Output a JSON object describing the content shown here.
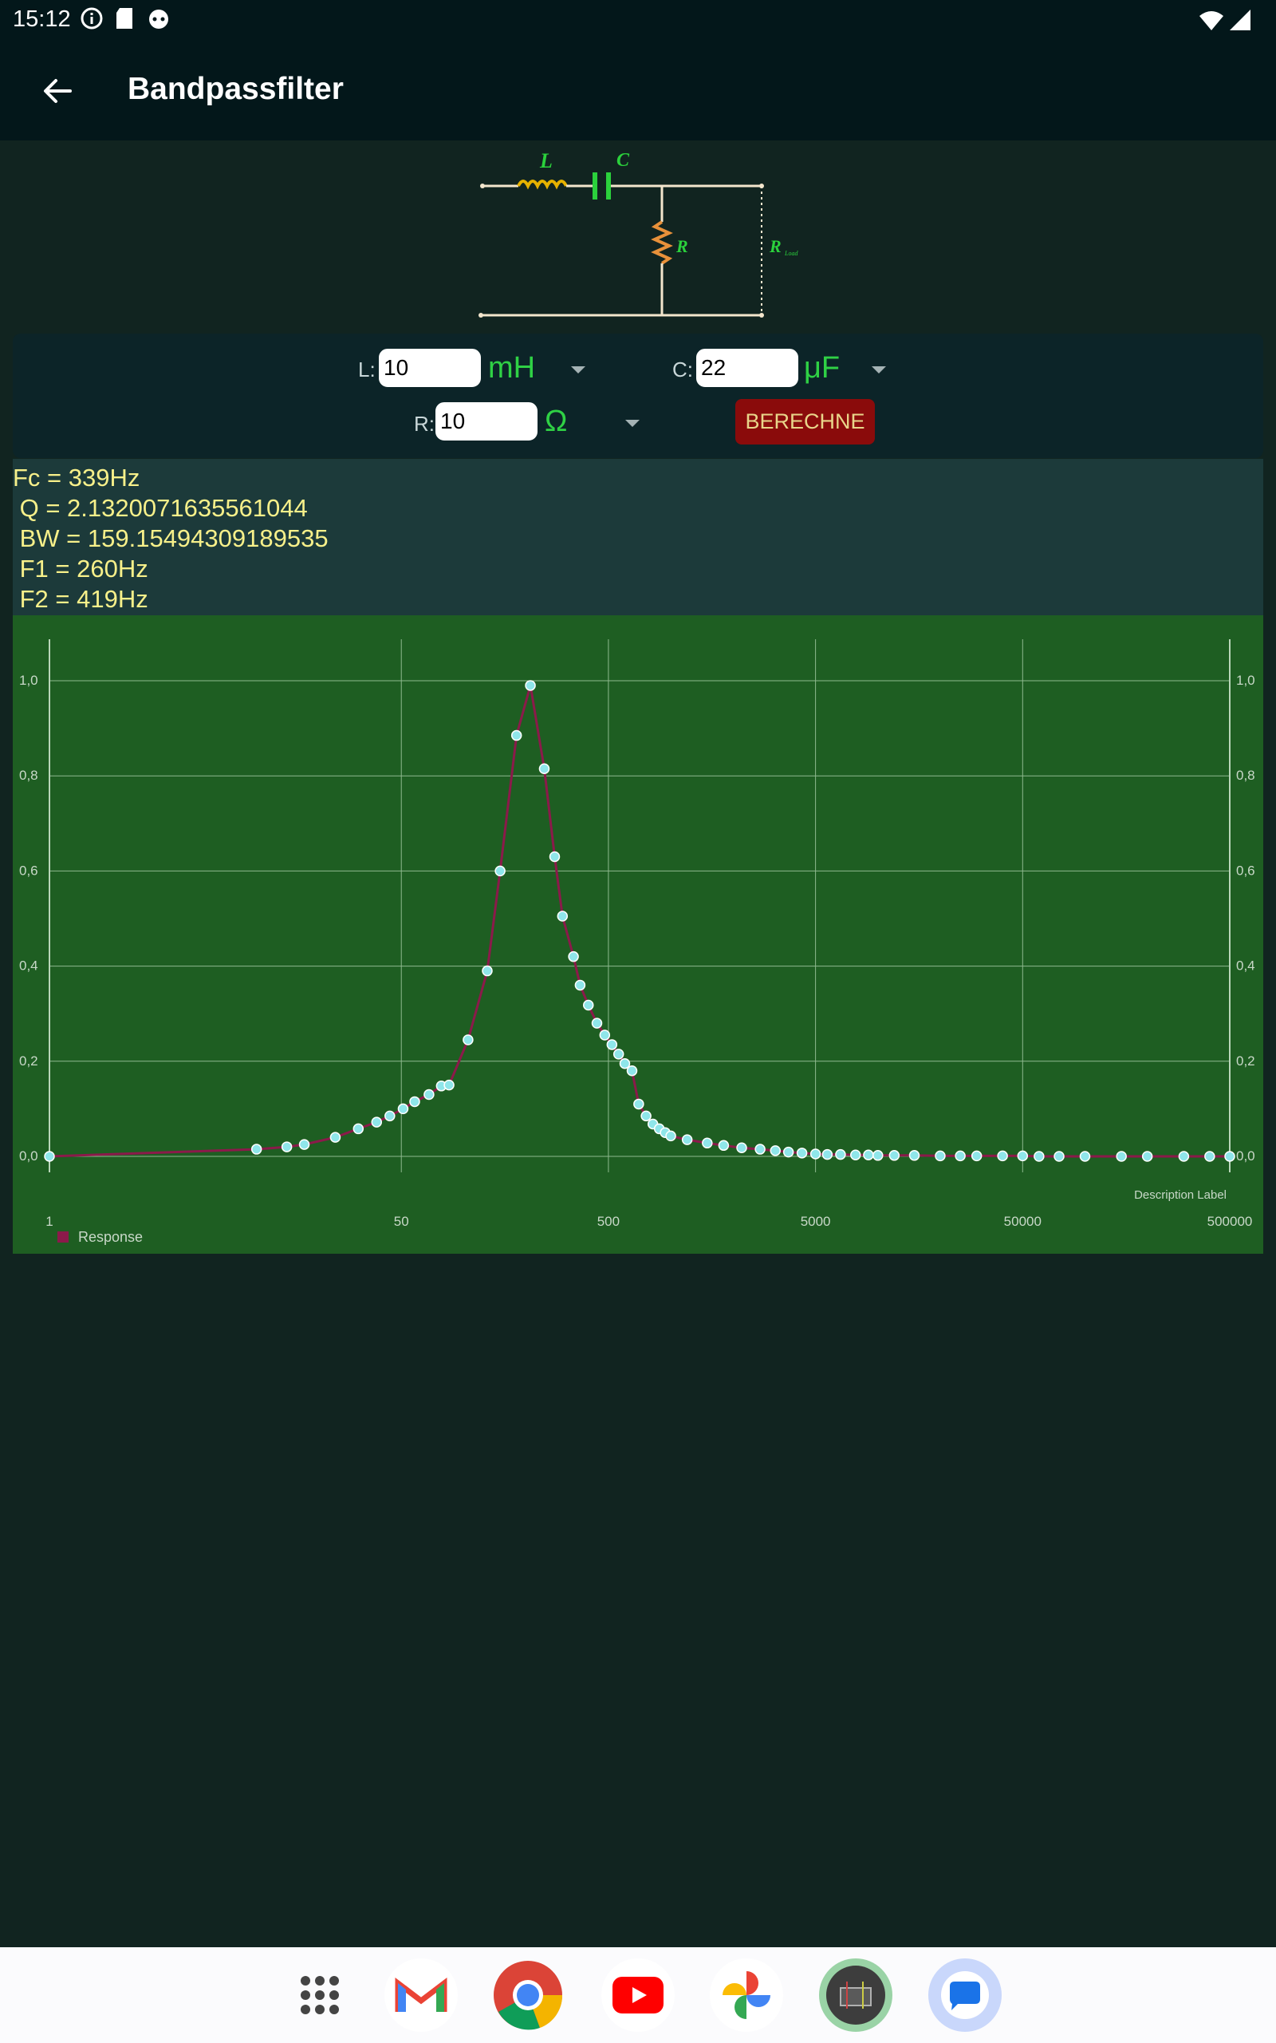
{
  "status_bar": {
    "time": "15:12",
    "icons": [
      "info-icon",
      "sd-card-icon",
      "robot-icon",
      "wifi-icon",
      "signal-icon"
    ]
  },
  "app_bar": {
    "title": "Bandpassfilter",
    "back_icon": "arrow-left-icon"
  },
  "circuit": {
    "label_L": "L",
    "label_C": "C",
    "label_R": "R",
    "label_RLoad": "R",
    "label_RLoad_sub": "Load"
  },
  "inputs": {
    "L": {
      "label": "L:",
      "value": "10",
      "unit": "mH"
    },
    "C": {
      "label": "C:",
      "value": "22",
      "unit": "μF"
    },
    "R": {
      "label": "R:",
      "value": "10",
      "unit": "Ω"
    },
    "calculate_label": "BERECHNE"
  },
  "results": {
    "fc": "Fc = 339Hz",
    "q": " Q = 2.1320071635561044",
    "bw": " BW = 159.15494309189535",
    "f1": " F1 = 260Hz",
    "f2": " F2 = 419Hz"
  },
  "colors": {
    "app_bar": "#03171a",
    "background": "#112420",
    "panel": "#0c2428",
    "results_bg": "#1c3a3a",
    "results_text": "#f7f08a",
    "chart_bg": "#1e5e22",
    "line": "#8b1a4a",
    "marker": "#8fe6ea",
    "button": "#8a0b0b",
    "unit_text": "#2fd145"
  },
  "chart_data": {
    "type": "line",
    "x_scale": "log",
    "xlim": [
      1,
      500000
    ],
    "ylim": [
      0,
      1
    ],
    "x_ticks": [
      "1",
      "50",
      "500",
      "5000",
      "50000",
      "500000"
    ],
    "y_ticks": [
      "0,0",
      "0,2",
      "0,4",
      "0,6",
      "0,8",
      "1,0"
    ],
    "grid": true,
    "description_label": "Description Label",
    "legend": {
      "position": "bottom-left",
      "entries": [
        "Response"
      ]
    },
    "series": [
      {
        "name": "Response",
        "x": [
          1,
          10,
          14,
          17,
          24,
          31,
          38,
          44,
          51,
          58,
          68,
          78,
          85,
          105,
          130,
          150,
          180,
          210,
          245,
          275,
          300,
          339,
          365,
          400,
          440,
          480,
          520,
          560,
          600,
          650,
          700,
          760,
          820,
          880,
          940,
          1000,
          1200,
          1500,
          1800,
          2200,
          2700,
          3200,
          3700,
          4300,
          5000,
          5700,
          6600,
          7800,
          9000,
          10000,
          12000,
          15000,
          20000,
          25000,
          30000,
          40000,
          50000,
          60000,
          75000,
          100000,
          150000,
          200000,
          300000,
          400000,
          500000
        ],
        "y": [
          0.0,
          0.015,
          0.02,
          0.025,
          0.04,
          0.058,
          0.072,
          0.085,
          0.1,
          0.115,
          0.13,
          0.148,
          0.15,
          0.245,
          0.39,
          0.6,
          0.885,
          0.99,
          0.815,
          0.63,
          0.505,
          0.42,
          0.36,
          0.318,
          0.28,
          0.255,
          0.235,
          0.215,
          0.195,
          0.18,
          0.11,
          0.085,
          0.068,
          0.058,
          0.05,
          0.043,
          0.035,
          0.028,
          0.023,
          0.018,
          0.015,
          0.012,
          0.009,
          0.007,
          0.005,
          0.004,
          0.004,
          0.003,
          0.003,
          0.002,
          0.002,
          0.002,
          0.001,
          0.001,
          0.001,
          0.001,
          0.001,
          0.0,
          0.0,
          0.0,
          0.0,
          0.0,
          0.0,
          0.0,
          0.0
        ]
      }
    ]
  },
  "dock": {
    "apps": [
      "app-drawer-icon",
      "gmail-icon",
      "chrome-icon",
      "youtube-icon",
      "photos-icon",
      "electronics-app-icon",
      "messages-icon"
    ]
  }
}
